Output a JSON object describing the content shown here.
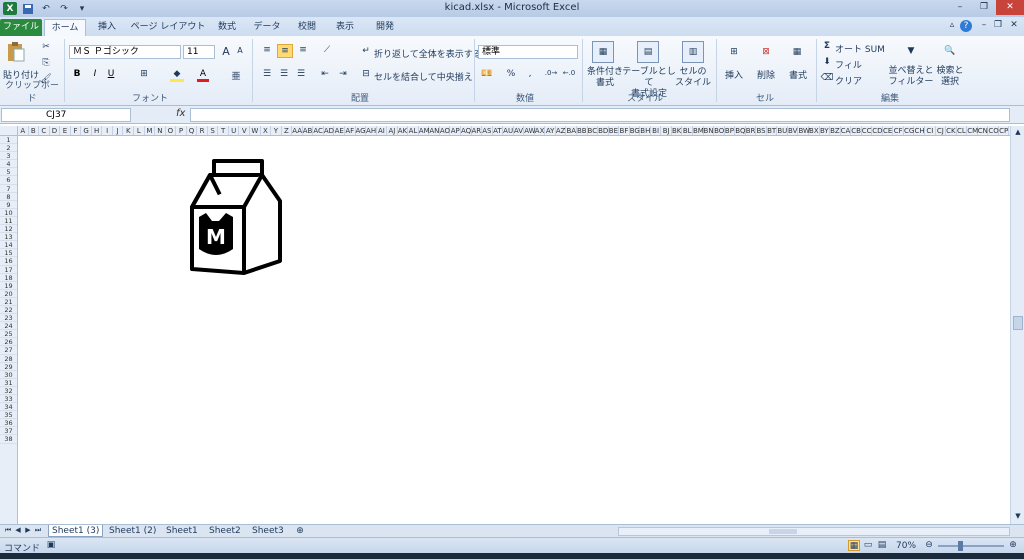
{
  "window": {
    "title": "kicad.xlsx - Microsoft Excel"
  },
  "qat": {
    "logo": "X"
  },
  "tabs": [
    {
      "label": "ファイル"
    },
    {
      "label": "ホーム"
    },
    {
      "label": "挿入"
    },
    {
      "label": "ページ レイアウト"
    },
    {
      "label": "数式"
    },
    {
      "label": "データ"
    },
    {
      "label": "校閲"
    },
    {
      "label": "表示"
    },
    {
      "label": "開発"
    }
  ],
  "clipboard": {
    "paste": "貼り付け",
    "group": "クリップボード"
  },
  "font": {
    "name": "ＭＳ Ｐゴシック",
    "size": "11",
    "bold": "B",
    "italic": "I",
    "underline": "U",
    "group": "フォント"
  },
  "alignment": {
    "wrap": "折り返して全体を表示する",
    "merge": "セルを結合して中央揃え",
    "group": "配置"
  },
  "number": {
    "format": "標準",
    "percent": "%",
    "comma": ",",
    "group": "数値"
  },
  "styles": {
    "conditional": "条件付き\n書式",
    "table": "テーブルとして\n書式設定",
    "cell": "セルの\nスタイル",
    "group": "スタイル"
  },
  "cells": {
    "insert": "挿入",
    "delete": "削除",
    "format": "書式",
    "group": "セル"
  },
  "editing": {
    "autosum": "オート SUM",
    "fill": "フィル",
    "clear": "クリア",
    "sort": "並べ替えと\nフィルター",
    "find": "検索と\n選択",
    "group": "編集"
  },
  "formula_bar": {
    "name_box": "CJ37",
    "fx": "fx",
    "value": ""
  },
  "columns": [
    "A",
    "B",
    "C",
    "D",
    "E",
    "F",
    "G",
    "H",
    "I",
    "J",
    "K",
    "L",
    "M",
    "N",
    "O",
    "P",
    "Q",
    "R",
    "S",
    "T",
    "U",
    "V",
    "W",
    "X",
    "Y",
    "Z",
    "AA",
    "AB",
    "AC",
    "AD",
    "AE",
    "AF",
    "AG",
    "AH",
    "AI",
    "AJ",
    "AK",
    "AL",
    "AM",
    "AN",
    "AO",
    "AP",
    "AQ",
    "AR",
    "AS",
    "AT",
    "AU",
    "AV",
    "AW",
    "AX",
    "AY",
    "AZ",
    "BA",
    "BB",
    "BC",
    "BD",
    "BE",
    "BF",
    "BG",
    "BH",
    "BI",
    "BJ",
    "BK",
    "BL",
    "BM",
    "BN",
    "BO",
    "BP",
    "BQ",
    "BR",
    "BS",
    "BT",
    "BU",
    "BV",
    "BW",
    "BX",
    "BY",
    "BZ",
    "CA",
    "CB",
    "CC",
    "CD",
    "CE",
    "CF",
    "CG",
    "CH",
    "CI",
    "CJ",
    "CK",
    "CL",
    "CM",
    "CN",
    "CO",
    "CP"
  ],
  "rows": [
    "1",
    "2",
    "3",
    "4",
    "5",
    "6",
    "7",
    "8",
    "9",
    "10",
    "11",
    "12",
    "13",
    "14",
    "15",
    "16",
    "17",
    "18",
    "19",
    "20",
    "21",
    "22",
    "23",
    "24",
    "25",
    "26",
    "27",
    "28",
    "29",
    "30",
    "31",
    "32",
    "33",
    "34",
    "35",
    "36",
    "37",
    "38"
  ],
  "sheets": [
    {
      "label": "Sheet1 (3)",
      "active": true
    },
    {
      "label": "Sheet1 (2)",
      "active": false
    },
    {
      "label": "Sheet1",
      "active": false
    },
    {
      "label": "Sheet2",
      "active": false
    },
    {
      "label": "Sheet3",
      "active": false
    }
  ],
  "status": {
    "mode": "コマンド",
    "zoom": "70%"
  },
  "drawing": {
    "letter": "M"
  }
}
